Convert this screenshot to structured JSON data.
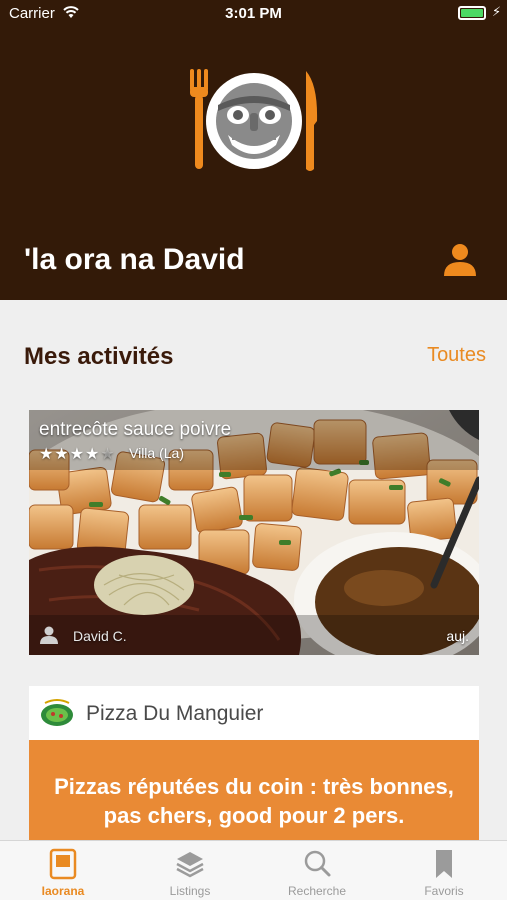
{
  "status_bar": {
    "carrier": "Carrier",
    "time": "3:01 PM",
    "battery_percent": 100
  },
  "header": {
    "greeting": "'la ora na David"
  },
  "activities": {
    "title": "Mes activités",
    "see_all": "Toutes",
    "post": {
      "dish": "entrecôte sauce poivre",
      "rating": 4,
      "rating_max": 5,
      "stars_filled": "★★★★",
      "stars_empty": "★",
      "place": "Villa (La)",
      "user": "David C.",
      "date": "auj."
    }
  },
  "restaurant_card": {
    "name": "Pizza Du Manguier",
    "review": "Pizzas réputées du coin : très bonnes, pas chers, good pour 2 pers."
  },
  "tabbar": {
    "items": [
      {
        "label": "Iaorana",
        "icon": "tray-icon",
        "active": true
      },
      {
        "label": "Listings",
        "icon": "layers-icon",
        "active": false
      },
      {
        "label": "Recherche",
        "icon": "search-icon",
        "active": false
      },
      {
        "label": "Favoris",
        "icon": "bookmark-icon",
        "active": false
      }
    ]
  },
  "colors": {
    "brand_dark": "#331a08",
    "accent": "#e98a22",
    "tab_inactive": "#9b9b9b"
  }
}
